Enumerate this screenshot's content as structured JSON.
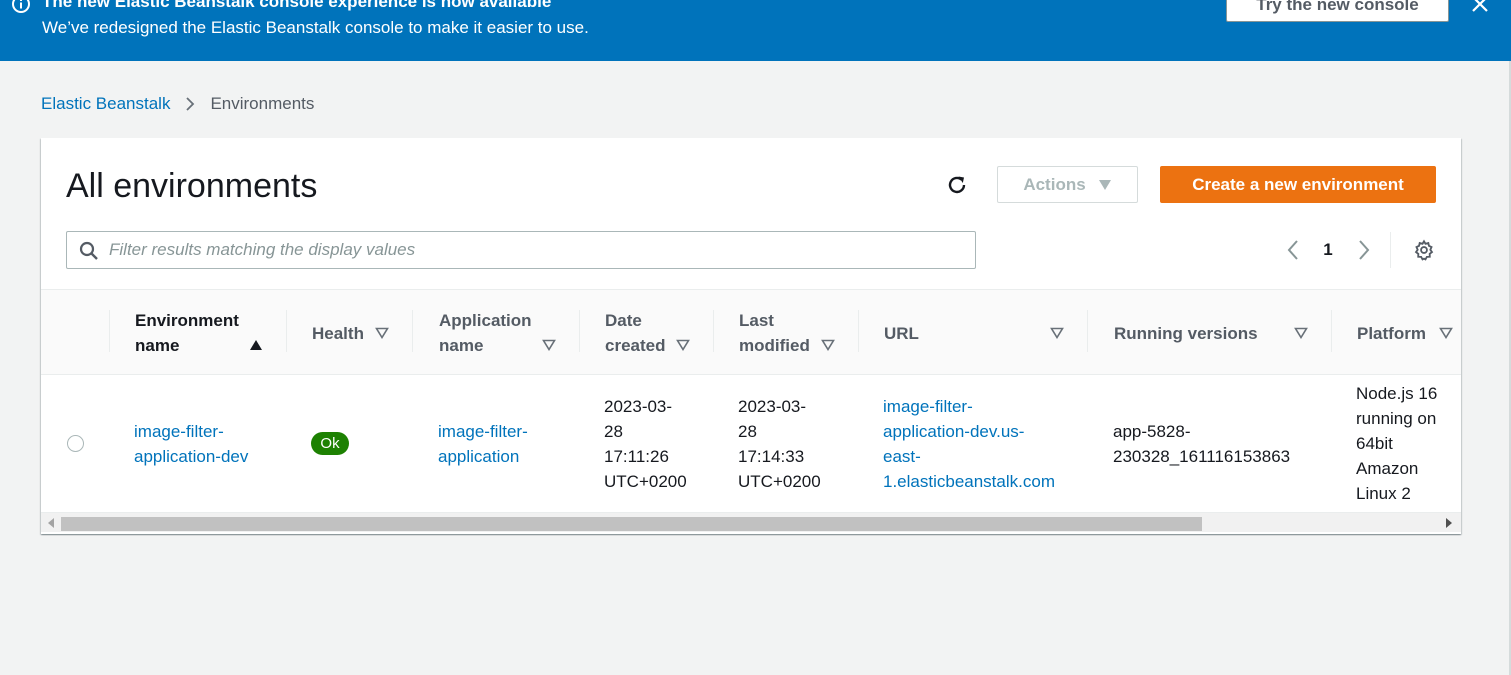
{
  "banner": {
    "title": "The new Elastic Beanstalk console experience is now available",
    "text": "We’ve redesigned the Elastic Beanstalk console to make it easier to use.",
    "button_label": "Try the new console",
    "icons": {
      "info": "info-icon",
      "close": "close-icon"
    }
  },
  "breadcrumb": {
    "items": [
      {
        "label": "Elastic Beanstalk"
      },
      {
        "label": "Environments"
      }
    ]
  },
  "panel": {
    "title": "All environments",
    "actions_label": "Actions",
    "create_label": "Create a new environment",
    "filter_placeholder": "Filter results matching the display values",
    "filter_value": "",
    "page_number": "1"
  },
  "table": {
    "columns": [
      {
        "line1": "Environment",
        "line2": "name",
        "sort": "ascending"
      },
      {
        "line1": "Health",
        "line2": ""
      },
      {
        "line1": "Application",
        "line2": "name"
      },
      {
        "line1": "Date",
        "line2": "created"
      },
      {
        "line1": "Last",
        "line2": "modified"
      },
      {
        "line1": "URL",
        "line2": ""
      },
      {
        "line1": "Running versions",
        "line2": ""
      },
      {
        "line1": "Platform",
        "line2": ""
      }
    ],
    "rows": [
      {
        "selected": false,
        "environment_name": [
          "image-filter-",
          "application-dev"
        ],
        "health": "Ok",
        "application_name": [
          "image-filter-",
          "application"
        ],
        "date_created": [
          "2023-03-",
          "28",
          "17:11:26",
          "UTC+0200"
        ],
        "last_modified": [
          "2023-03-",
          "28",
          "17:14:33",
          "UTC+0200"
        ],
        "url": [
          "image-filter-",
          "application-dev.us-",
          "east-",
          "1.elasticbeanstalk.com"
        ],
        "running_versions": [
          "app-5828-",
          "230328_161116153863"
        ],
        "platform": [
          "Node.js 16",
          "running on",
          "64bit",
          "Amazon",
          "Linux 2"
        ]
      }
    ]
  },
  "colors": {
    "banner": "#0073bb",
    "primary_button": "#ec7211",
    "link": "#0073bb",
    "health_ok": "#1d8102"
  }
}
